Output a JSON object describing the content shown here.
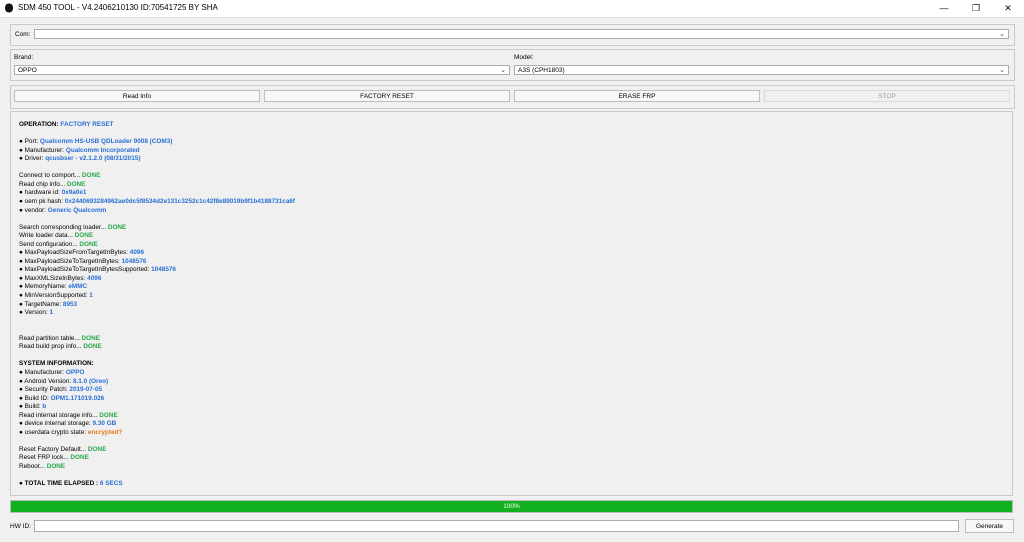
{
  "window": {
    "title": "SDM 450 TOOL - V4.2406210130 ID:70541725 BY SHA",
    "min": "—",
    "max": "❐",
    "close": "✕"
  },
  "com": {
    "label": "Com:",
    "value": ""
  },
  "brand": {
    "label": "Brand:",
    "value": "OPPO"
  },
  "model": {
    "label": "Model:",
    "value": "A3S (CPH1803)"
  },
  "buttons": {
    "read_info": "Read Info",
    "factory_reset": "FACTORY RESET",
    "erase_frp": "ERASE FRP",
    "stop": "STOP"
  },
  "log": [
    {
      "parts": [
        {
          "t": "OPERATION: ",
          "c": "hdr"
        },
        {
          "t": "FACTORY RESET",
          "c": "blue"
        }
      ]
    },
    {
      "parts": []
    },
    {
      "parts": [
        {
          "t": " ● Port: "
        },
        {
          "t": "Qualcomm HS-USB QDLoader 9008 (COM3)",
          "c": "blue"
        }
      ]
    },
    {
      "parts": [
        {
          "t": " ● Manufacturer: "
        },
        {
          "t": "Qualcomm Incorporated",
          "c": "blue"
        }
      ]
    },
    {
      "parts": [
        {
          "t": " ● Driver: "
        },
        {
          "t": "qcusbser - v2.1.2.0 (08/31/2015)",
          "c": "blue"
        }
      ]
    },
    {
      "parts": []
    },
    {
      "parts": [
        {
          "t": "Connect to comport... "
        },
        {
          "t": "DONE",
          "c": "green"
        }
      ]
    },
    {
      "parts": [
        {
          "t": "Read chip info... "
        },
        {
          "t": "DONE",
          "c": "green"
        }
      ]
    },
    {
      "parts": [
        {
          "t": " ● hardware id: "
        },
        {
          "t": "0x9a0e1",
          "c": "blue"
        }
      ]
    },
    {
      "parts": [
        {
          "t": " ● oem pk hash: "
        },
        {
          "t": "0x2440693284962ae0dc5f8534d2e131c3252c1c42f8e89019b9f1b4188731ca6f",
          "c": "blue"
        }
      ]
    },
    {
      "parts": [
        {
          "t": " ● vendor: "
        },
        {
          "t": "Generic Qualcomm",
          "c": "blue"
        }
      ]
    },
    {
      "parts": []
    },
    {
      "parts": [
        {
          "t": "Search corresponding loader... "
        },
        {
          "t": "DONE",
          "c": "green"
        }
      ]
    },
    {
      "parts": [
        {
          "t": "Write loader data... "
        },
        {
          "t": "DONE",
          "c": "green"
        }
      ]
    },
    {
      "parts": [
        {
          "t": "Send configuration... "
        },
        {
          "t": "DONE",
          "c": "green"
        }
      ]
    },
    {
      "parts": [
        {
          "t": " ● MaxPayloadSizeFromTargetInBytes: "
        },
        {
          "t": "4096",
          "c": "blue"
        }
      ]
    },
    {
      "parts": [
        {
          "t": " ● MaxPayloadSizeToTargetInBytes: "
        },
        {
          "t": "1048576",
          "c": "blue"
        }
      ]
    },
    {
      "parts": [
        {
          "t": " ● MaxPayloadSizeToTargetInBytesSupported: "
        },
        {
          "t": "1048576",
          "c": "blue"
        }
      ]
    },
    {
      "parts": [
        {
          "t": " ● MaxXMLSizeInBytes: "
        },
        {
          "t": "4096",
          "c": "blue"
        }
      ]
    },
    {
      "parts": [
        {
          "t": " ● MemoryName: "
        },
        {
          "t": "eMMC",
          "c": "blue"
        }
      ]
    },
    {
      "parts": [
        {
          "t": " ● MinVersionSupported: "
        },
        {
          "t": "1",
          "c": "blue"
        }
      ]
    },
    {
      "parts": [
        {
          "t": " ● TargetName: "
        },
        {
          "t": "8953",
          "c": "blue"
        }
      ]
    },
    {
      "parts": [
        {
          "t": " ● Version: "
        },
        {
          "t": "1",
          "c": "blue"
        }
      ]
    },
    {
      "parts": []
    },
    {
      "parts": []
    },
    {
      "parts": [
        {
          "t": "Read partition table... "
        },
        {
          "t": "DONE",
          "c": "green"
        }
      ]
    },
    {
      "parts": [
        {
          "t": "Read build prop info... "
        },
        {
          "t": "DONE",
          "c": "green"
        }
      ]
    },
    {
      "parts": []
    },
    {
      "parts": [
        {
          "t": "SYSTEM INFORMATION:",
          "c": "hdr"
        }
      ]
    },
    {
      "parts": [
        {
          "t": " ●  Manufacturer: "
        },
        {
          "t": "OPPO",
          "c": "blue"
        }
      ]
    },
    {
      "parts": [
        {
          "t": " ●  Android Version: "
        },
        {
          "t": "8.1.0 (Oreo)",
          "c": "blue"
        }
      ]
    },
    {
      "parts": [
        {
          "t": " ●  Security Patch: "
        },
        {
          "t": "2019-07-05",
          "c": "blue"
        }
      ]
    },
    {
      "parts": [
        {
          "t": " ●  Build ID: "
        },
        {
          "t": "OPM1.171019.026",
          "c": "blue"
        }
      ]
    },
    {
      "parts": [
        {
          "t": " ●  Build: "
        },
        {
          "t": "b",
          "c": "blue"
        }
      ]
    },
    {
      "parts": [
        {
          "t": "Read internal storage info... "
        },
        {
          "t": "DONE",
          "c": "green"
        }
      ]
    },
    {
      "parts": [
        {
          "t": " ● device internal storage: "
        },
        {
          "t": "9.30 GB",
          "c": "blue"
        }
      ]
    },
    {
      "parts": [
        {
          "t": " ● userdata crypto state: "
        },
        {
          "t": "encrypted?",
          "c": "orange"
        }
      ]
    },
    {
      "parts": []
    },
    {
      "parts": [
        {
          "t": "Reset Factory Default... "
        },
        {
          "t": "DONE",
          "c": "green"
        }
      ]
    },
    {
      "parts": [
        {
          "t": "Reset FRP lock... "
        },
        {
          "t": "DONE",
          "c": "green"
        }
      ]
    },
    {
      "parts": [
        {
          "t": "Reboot... "
        },
        {
          "t": "DONE",
          "c": "green"
        }
      ]
    },
    {
      "parts": []
    },
    {
      "parts": [
        {
          "t": " ● TOTAL TIME ELAPSED : ",
          "c": "hdr"
        },
        {
          "t": "6 SECS",
          "c": "blue"
        }
      ]
    }
  ],
  "progress": {
    "value": 1.0,
    "label": "100%",
    "color": "#11b01f"
  },
  "hwid": {
    "label": "HW ID:",
    "value": "",
    "generate": "Generate"
  },
  "colors": {
    "blue": "#2a6fd6",
    "green": "#2aa84a",
    "orange": "#e07a1b"
  }
}
